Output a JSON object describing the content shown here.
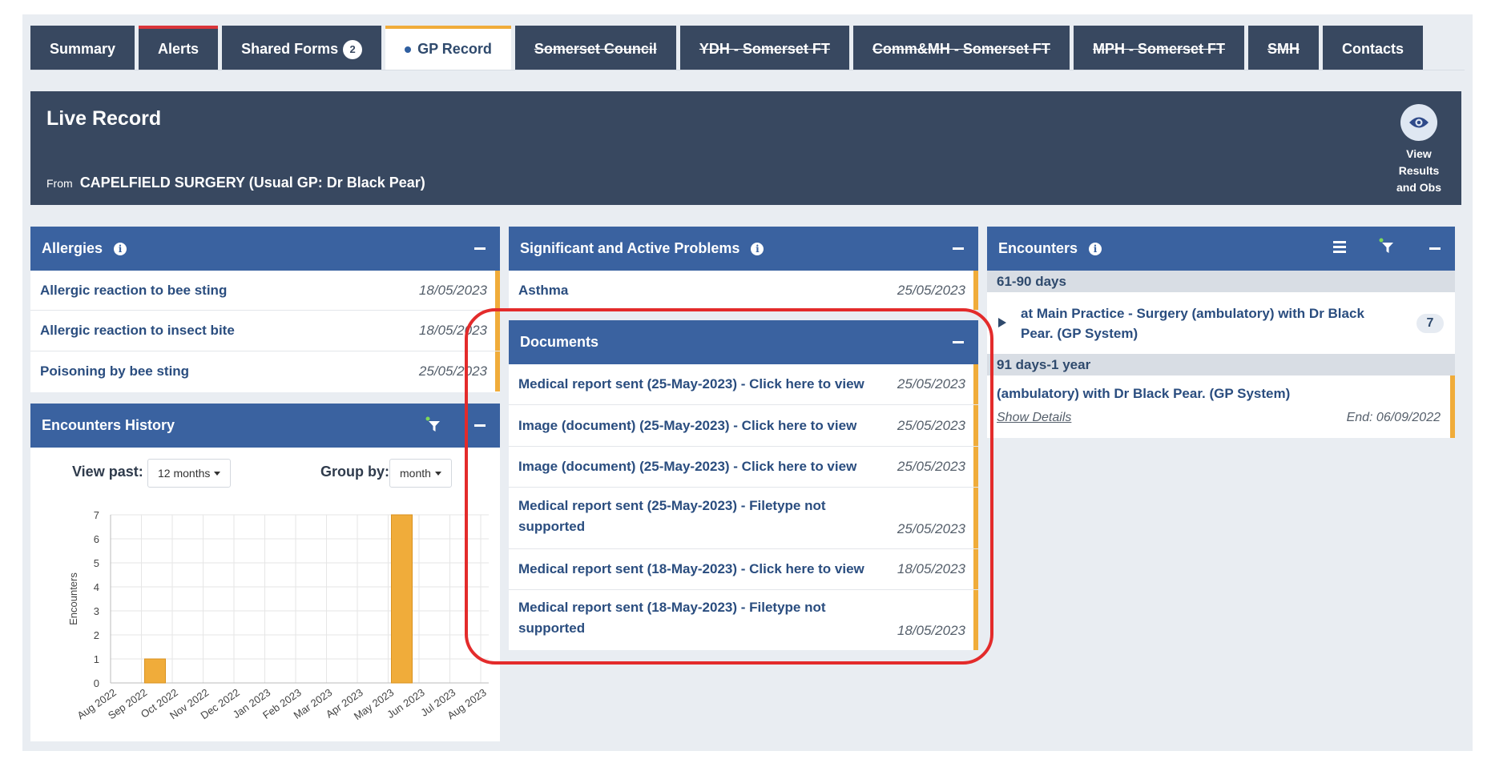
{
  "tabs": [
    {
      "label": "Summary",
      "style": "normal"
    },
    {
      "label": "Alerts",
      "style": "alert"
    },
    {
      "label": "Shared Forms",
      "badge": "2",
      "style": "normal"
    },
    {
      "label": "GP Record",
      "style": "active"
    },
    {
      "label": "Somerset Council",
      "style": "strike"
    },
    {
      "label": "YDH - Somerset FT",
      "style": "strike"
    },
    {
      "label": "Comm&MH - Somerset FT",
      "style": "strike"
    },
    {
      "label": "MPH - Somerset FT",
      "style": "strike"
    },
    {
      "label": "SMH",
      "style": "strike"
    },
    {
      "label": "Contacts",
      "style": "normal"
    }
  ],
  "banner": {
    "title": "Live Record",
    "from_prefix": "From",
    "from_text": "CAPELFIELD SURGERY (Usual GP: Dr Black Pear)",
    "view_button": {
      "line1": "View",
      "line2": "Results",
      "line3": "and Obs",
      "icon": "eye-icon"
    }
  },
  "allergies": {
    "title": "Allergies",
    "items": [
      {
        "text": "Allergic reaction to bee sting",
        "date": "18/05/2023"
      },
      {
        "text": "Allergic reaction to insect bite",
        "date": "18/05/2023"
      },
      {
        "text": "Poisoning by bee sting",
        "date": "25/05/2023"
      }
    ]
  },
  "encounters_history": {
    "title": "Encounters History",
    "view_past_label": "View past:",
    "view_past_value": "12 months",
    "group_by_label": "Group by:",
    "group_by_value": "month"
  },
  "chart_data": {
    "type": "bar",
    "categories": [
      "Aug 2022",
      "Sep 2022",
      "Oct 2022",
      "Nov 2022",
      "Dec 2022",
      "Jan 2023",
      "Feb 2023",
      "Mar 2023",
      "Apr 2023",
      "May 2023",
      "Jun 2023",
      "Jul 2023",
      "Aug 2023"
    ],
    "values": [
      0,
      1,
      0,
      0,
      0,
      0,
      0,
      0,
      0,
      7,
      0,
      0,
      0
    ],
    "ylabel": "Encounters",
    "ylim": [
      0,
      7
    ],
    "yticks": [
      "0",
      "1",
      "2",
      "3",
      "4",
      "5",
      "6",
      "7"
    ],
    "grid": true,
    "bar_color": "#f0ac3a"
  },
  "problems": {
    "title": "Significant and Active Problems",
    "items": [
      {
        "text": "Asthma",
        "date": "25/05/2023"
      }
    ]
  },
  "documents": {
    "title": "Documents",
    "items": [
      {
        "text": "Medical report sent (25-May-2023) - Click here to view",
        "date": "25/05/2023"
      },
      {
        "text": "Image (document) (25-May-2023) - Click here to view",
        "date": "25/05/2023"
      },
      {
        "text": "Image (document) (25-May-2023) - Click here to view",
        "date": "25/05/2023"
      },
      {
        "text": "Medical report sent (25-May-2023) - Filetype not supported",
        "date": "25/05/2023"
      },
      {
        "text": "Medical report sent (18-May-2023) - Click here to view",
        "date": "18/05/2023"
      },
      {
        "text": "Medical report sent (18-May-2023) - Filetype not supported",
        "date": "18/05/2023"
      }
    ]
  },
  "encounters": {
    "title": "Encounters",
    "group1": "61-90 days",
    "group1_item": {
      "text": "at Main Practice - Surgery (ambulatory) with Dr Black Pear. (GP System)",
      "count": "7"
    },
    "group2": "91 days-1 year",
    "group2_item": {
      "text": "(ambulatory) with Dr Black Pear. (GP System)",
      "details": "Show Details",
      "end": "End: 06/09/2022"
    }
  },
  "colors": {
    "header_dark": "#384860",
    "panel_header": "#3a62a0",
    "accent": "#f0ac3a",
    "highlight": "#e32b2b"
  }
}
